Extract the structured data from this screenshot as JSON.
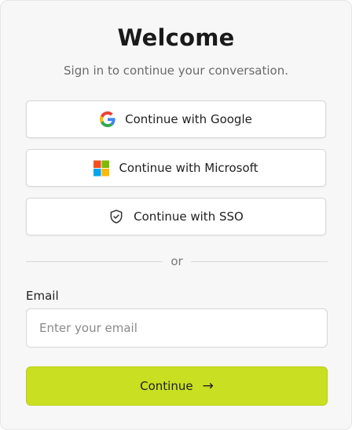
{
  "header": {
    "title": "Welcome",
    "subtitle": "Sign in to continue your conversation."
  },
  "providers": {
    "google_label": "Continue with Google",
    "microsoft_label": "Continue with Microsoft",
    "sso_label": "Continue with SSO"
  },
  "divider": {
    "text": "or"
  },
  "email": {
    "label": "Email",
    "placeholder": "Enter your email",
    "value": ""
  },
  "submit": {
    "label": "Continue",
    "arrow": "→"
  },
  "colors": {
    "accent": "#c8df22",
    "background": "#f7f7f7"
  },
  "icons": {
    "google": "google-logo-icon",
    "microsoft": "microsoft-logo-icon",
    "sso": "shield-check-icon",
    "arrow": "arrow-right-icon"
  }
}
